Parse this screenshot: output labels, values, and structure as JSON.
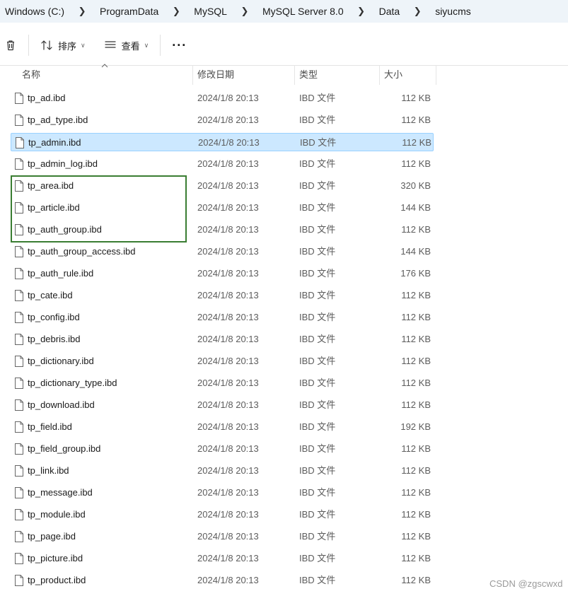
{
  "breadcrumb": [
    "Windows (C:)",
    "ProgramData",
    "MySQL",
    "MySQL Server 8.0",
    "Data",
    "siyucms"
  ],
  "toolbar": {
    "sort_label": "排序",
    "view_label": "查看",
    "more_label": "···"
  },
  "columns": {
    "name": "名称",
    "date": "修改日期",
    "type": "类型",
    "size": "大小"
  },
  "files": [
    {
      "name": "tp_ad.ibd",
      "date": "2024/1/8 20:13",
      "type": "IBD 文件",
      "size": "112 KB"
    },
    {
      "name": "tp_ad_type.ibd",
      "date": "2024/1/8 20:13",
      "type": "IBD 文件",
      "size": "112 KB"
    },
    {
      "name": "tp_admin.ibd",
      "date": "2024/1/8 20:13",
      "type": "IBD 文件",
      "size": "112 KB",
      "selected": true
    },
    {
      "name": "tp_admin_log.ibd",
      "date": "2024/1/8 20:13",
      "type": "IBD 文件",
      "size": "112 KB"
    },
    {
      "name": "tp_area.ibd",
      "date": "2024/1/8 20:13",
      "type": "IBD 文件",
      "size": "320 KB"
    },
    {
      "name": "tp_article.ibd",
      "date": "2024/1/8 20:13",
      "type": "IBD 文件",
      "size": "144 KB"
    },
    {
      "name": "tp_auth_group.ibd",
      "date": "2024/1/8 20:13",
      "type": "IBD 文件",
      "size": "112 KB"
    },
    {
      "name": "tp_auth_group_access.ibd",
      "date": "2024/1/8 20:13",
      "type": "IBD 文件",
      "size": "144 KB"
    },
    {
      "name": "tp_auth_rule.ibd",
      "date": "2024/1/8 20:13",
      "type": "IBD 文件",
      "size": "176 KB"
    },
    {
      "name": "tp_cate.ibd",
      "date": "2024/1/8 20:13",
      "type": "IBD 文件",
      "size": "112 KB"
    },
    {
      "name": "tp_config.ibd",
      "date": "2024/1/8 20:13",
      "type": "IBD 文件",
      "size": "112 KB"
    },
    {
      "name": "tp_debris.ibd",
      "date": "2024/1/8 20:13",
      "type": "IBD 文件",
      "size": "112 KB"
    },
    {
      "name": "tp_dictionary.ibd",
      "date": "2024/1/8 20:13",
      "type": "IBD 文件",
      "size": "112 KB"
    },
    {
      "name": "tp_dictionary_type.ibd",
      "date": "2024/1/8 20:13",
      "type": "IBD 文件",
      "size": "112 KB"
    },
    {
      "name": "tp_download.ibd",
      "date": "2024/1/8 20:13",
      "type": "IBD 文件",
      "size": "112 KB"
    },
    {
      "name": "tp_field.ibd",
      "date": "2024/1/8 20:13",
      "type": "IBD 文件",
      "size": "192 KB"
    },
    {
      "name": "tp_field_group.ibd",
      "date": "2024/1/8 20:13",
      "type": "IBD 文件",
      "size": "112 KB"
    },
    {
      "name": "tp_link.ibd",
      "date": "2024/1/8 20:13",
      "type": "IBD 文件",
      "size": "112 KB"
    },
    {
      "name": "tp_message.ibd",
      "date": "2024/1/8 20:13",
      "type": "IBD 文件",
      "size": "112 KB"
    },
    {
      "name": "tp_module.ibd",
      "date": "2024/1/8 20:13",
      "type": "IBD 文件",
      "size": "112 KB"
    },
    {
      "name": "tp_page.ibd",
      "date": "2024/1/8 20:13",
      "type": "IBD 文件",
      "size": "112 KB"
    },
    {
      "name": "tp_picture.ibd",
      "date": "2024/1/8 20:13",
      "type": "IBD 文件",
      "size": "112 KB"
    },
    {
      "name": "tp_product.ibd",
      "date": "2024/1/8 20:13",
      "type": "IBD 文件",
      "size": "112 KB"
    }
  ],
  "watermark": "CSDN @zgscwxd",
  "colors": {
    "breadcrumb_bg": "#eef4f9",
    "selection_bg": "#cce8ff",
    "selection_border": "#99d1ff",
    "highlight_box": "#3a7d32"
  },
  "icons": {
    "delete": "trash-icon",
    "sort": "sort-arrows-icon",
    "view": "view-list-icon",
    "file": "file-icon"
  }
}
